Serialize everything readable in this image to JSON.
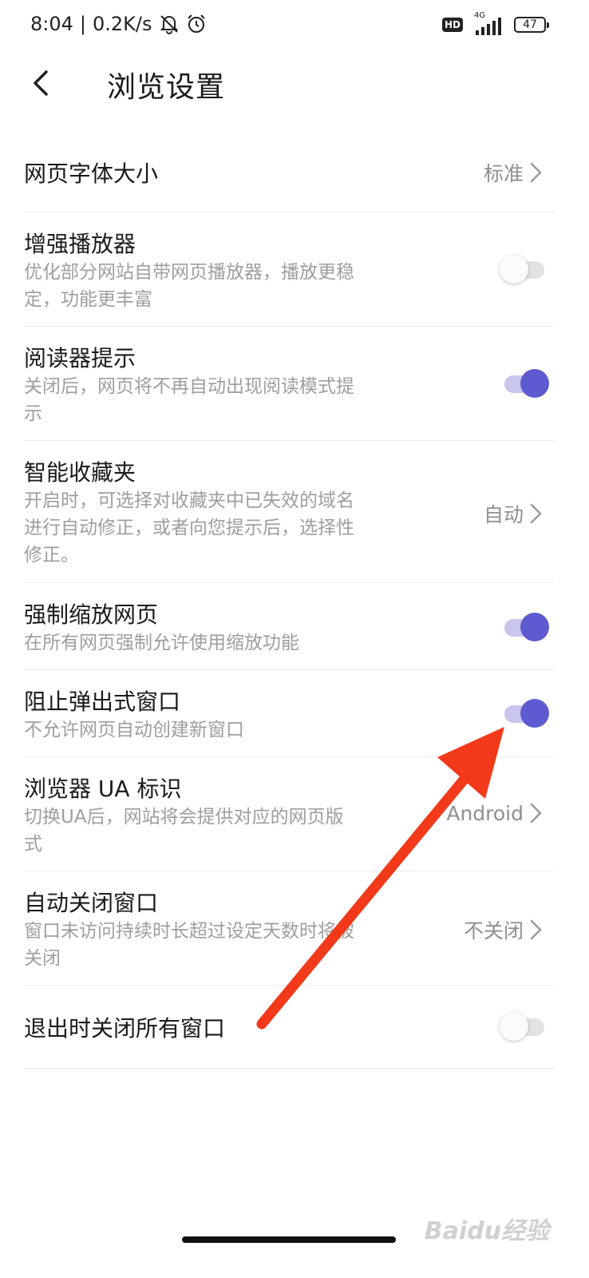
{
  "status_bar": {
    "time": "8:04",
    "speed": "0.2K/s",
    "network_badge": "HD",
    "network_type": "4G",
    "battery": "47"
  },
  "header": {
    "title": "浏览设置",
    "back_icon": "chevron-left-icon"
  },
  "settings": [
    {
      "title": "网页字体大小",
      "value": "标准",
      "control": "chevron"
    },
    {
      "title": "增强播放器",
      "description": "优化部分网站自带网页播放器，播放更稳定，功能更丰富",
      "control": "toggle",
      "enabled": false
    },
    {
      "title": "阅读器提示",
      "description": "关闭后，网页将不再自动出现阅读模式提示",
      "control": "toggle",
      "enabled": true
    },
    {
      "title": "智能收藏夹",
      "description": "开启时，可选择对收藏夹中已失效的域名进行自动修正，或者向您提示后，选择性修正。",
      "value": "自动",
      "control": "chevron"
    },
    {
      "title": "强制缩放网页",
      "description": "在所有网页强制允许使用缩放功能",
      "control": "toggle",
      "enabled": true
    },
    {
      "title": "阻止弹出式窗口",
      "description": "不允许网页自动创建新窗口",
      "control": "toggle",
      "enabled": true
    },
    {
      "title": "浏览器 UA 标识",
      "description": "切换UA后，网站将会提供对应的网页版式",
      "value": "Android",
      "control": "chevron"
    },
    {
      "title": "自动关闭窗口",
      "description": "窗口未访问持续时长超过设定天数时将被关闭",
      "value": "不关闭",
      "control": "chevron"
    },
    {
      "title": "退出时关闭所有窗口",
      "control": "toggle",
      "enabled": false
    }
  ],
  "colors": {
    "accent": "#5e5acf",
    "accent_track": "#c8c6ee",
    "annotation_arrow": "#f23a1a"
  },
  "watermark": "Baidu经验"
}
